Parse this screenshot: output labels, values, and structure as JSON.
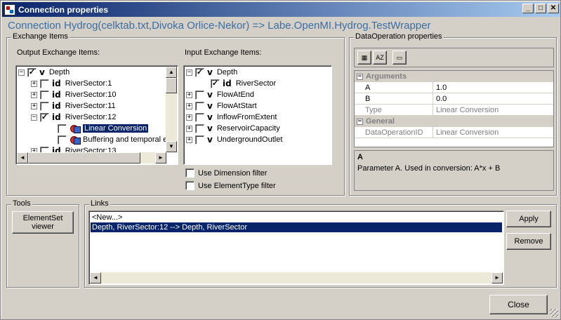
{
  "window": {
    "title": "Connection properties",
    "min": "_",
    "max": "□",
    "close": "✕"
  },
  "heading": "Connection Hydrog(celktab.txt,Divoka Orlice-Nekor) => Labe.OpenMI.Hydrog.TestWrapper",
  "exchange": {
    "group_label": "Exchange Items",
    "output_label": "Output Exchange Items:",
    "input_label": "Input Exchange Items:",
    "output_items": [
      {
        "text": "Depth",
        "icon": "v",
        "checked": true,
        "expanded": true
      },
      {
        "text": "RiverSector:1",
        "icon": "id",
        "checked": false
      },
      {
        "text": "RiverSector:10",
        "icon": "id",
        "checked": false
      },
      {
        "text": "RiverSector:11",
        "icon": "id",
        "checked": false
      },
      {
        "text": "RiverSector:12",
        "icon": "id",
        "checked": true,
        "expanded": true
      },
      {
        "text": "Linear Conversion",
        "checked": false
      },
      {
        "text": "Buffering and temporal e",
        "checked": false
      },
      {
        "text": "RiverSector:13",
        "icon": "id",
        "checked": false
      }
    ],
    "input_items": [
      {
        "text": "Depth",
        "icon": "v",
        "checked": true
      },
      {
        "text": "RiverSector",
        "icon": "id",
        "checked": true
      },
      {
        "text": "FlowAtEnd",
        "icon": "v",
        "checked": false
      },
      {
        "text": "FlowAtStart",
        "icon": "v",
        "checked": false
      },
      {
        "text": "InflowFromExtent",
        "icon": "v",
        "checked": false
      },
      {
        "text": "ReservoirCapacity",
        "icon": "v",
        "checked": false
      },
      {
        "text": "UndergroundOutlet",
        "icon": "v",
        "checked": false
      }
    ],
    "filter_dimension": "Use Dimension filter",
    "filter_elementtype": "Use ElementType filter"
  },
  "dataop": {
    "group_label": "DataOperation properties",
    "cat_arguments": "Arguments",
    "cat_general": "General",
    "props": [
      {
        "name": "A",
        "value": "1.0"
      },
      {
        "name": "B",
        "value": "0.0"
      },
      {
        "name": "Type",
        "value": "Linear Conversion"
      },
      {
        "name": "DataOperationID",
        "value": "Linear Conversion"
      }
    ],
    "desc_title": "A",
    "desc_text": "Parameter A. Used in conversion: A*x + B"
  },
  "tools": {
    "group_label": "Tools",
    "elementset_viewer": "ElementSet viewer"
  },
  "links": {
    "group_label": "Links",
    "items": [
      "<New...>",
      "Depth, RiverSector:12 --> Depth, RiverSector"
    ],
    "apply": "Apply",
    "remove": "Remove"
  },
  "close_button": "Close",
  "icons": {
    "plus": "+",
    "minus": "−",
    "check": "✓",
    "up": "▲",
    "down": "▼",
    "left": "◄",
    "right": "►"
  }
}
